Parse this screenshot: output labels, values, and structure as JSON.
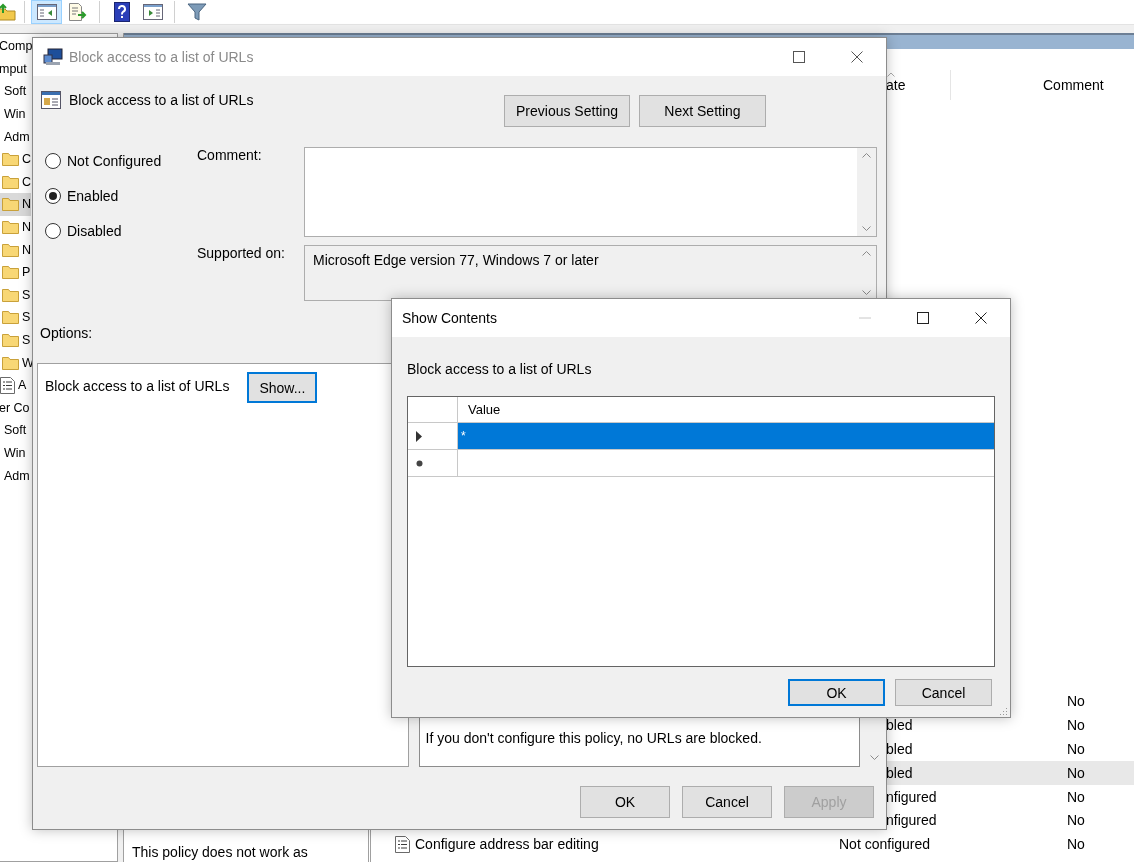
{
  "toolbar": {
    "buttons": [
      {
        "kind": "up",
        "selected": false
      },
      {
        "kind": "tree_pane",
        "selected": true
      },
      {
        "kind": "export",
        "selected": false
      },
      {
        "kind": "help",
        "selected": false
      },
      {
        "kind": "action_pane",
        "selected": false
      },
      {
        "kind": "filter",
        "selected": false
      }
    ]
  },
  "tree": {
    "items": [
      {
        "kind": "node",
        "label": "Comp",
        "selected": false
      },
      {
        "kind": "node",
        "label": "mput",
        "selected": false
      },
      {
        "kind": "child",
        "label": "Soft",
        "selected": false
      },
      {
        "kind": "child",
        "label": "Win",
        "selected": false
      },
      {
        "kind": "child",
        "label": "Adm",
        "selected": false
      },
      {
        "kind": "folder",
        "label": "C",
        "selected": false
      },
      {
        "kind": "folder",
        "label": "C",
        "selected": false
      },
      {
        "kind": "folder",
        "label": "N",
        "selected": true
      },
      {
        "kind": "folder",
        "label": "N",
        "selected": false
      },
      {
        "kind": "folder",
        "label": "N",
        "selected": false
      },
      {
        "kind": "folder",
        "label": "P",
        "selected": false
      },
      {
        "kind": "folder",
        "label": "S",
        "selected": false
      },
      {
        "kind": "folder",
        "label": "S",
        "selected": false
      },
      {
        "kind": "folder",
        "label": "S",
        "selected": false
      },
      {
        "kind": "folder",
        "label": "W",
        "selected": false
      },
      {
        "kind": "policy",
        "label": "A",
        "selected": false
      },
      {
        "kind": "node",
        "label": "er Co",
        "selected": false
      },
      {
        "kind": "child",
        "label": "Soft",
        "selected": false
      },
      {
        "kind": "child",
        "label": "Win",
        "selected": false
      },
      {
        "kind": "child",
        "label": "Adm",
        "selected": false
      }
    ]
  },
  "description": "This policy does not work as",
  "list": {
    "columns": [
      "ate",
      "Comment"
    ],
    "rows": [
      {
        "comment": "No",
        "selected": false
      },
      {
        "state": "bled",
        "comment": "No",
        "selected": false
      },
      {
        "state": "bled",
        "comment": "No",
        "selected": false
      },
      {
        "state": "bled",
        "comment": "No",
        "selected": true
      },
      {
        "state": "nfigured",
        "comment": "No",
        "selected": false
      },
      {
        "state": "nfigured",
        "comment": "No",
        "selected": false
      },
      {
        "name": "Configure address bar editing",
        "state": "Not configured",
        "comment": "No",
        "selected": false
      }
    ]
  },
  "policy_dialog": {
    "title": "Block access to a list of URLs",
    "heading": "Block access to a list of URLs",
    "nav_buttons": [
      "Previous Setting",
      "Next Setting"
    ],
    "options": [
      {
        "label": "Not Configured",
        "selected": false
      },
      {
        "label": "Enabled",
        "selected": true
      },
      {
        "label": "Disabled",
        "selected": false
      }
    ],
    "comment_label": "Comment:",
    "supported_label": "Supported on:",
    "supported_on": "Microsoft Edge version 77, Windows 7 or later",
    "options_label": "Options:",
    "option_text": "Block access to a list of URLs",
    "show_button": {
      "label": "Show...",
      "focused": true
    },
    "help_text": "If you don't configure this policy, no URLs are blocked.",
    "buttons": [
      {
        "label": "OK",
        "disabled": false
      },
      {
        "label": "Cancel",
        "disabled": false
      },
      {
        "label": "Apply",
        "disabled": true
      }
    ]
  },
  "show_contents": {
    "title": "Show Contents",
    "label": "Block access to a list of URLs",
    "column": "Value",
    "rows": [
      {
        "kind": "entry",
        "value": "*",
        "selected": true
      },
      {
        "kind": "new",
        "selected": false
      }
    ],
    "buttons": [
      {
        "label": "OK",
        "focused": true
      },
      {
        "label": "Cancel",
        "focused": false
      }
    ]
  }
}
